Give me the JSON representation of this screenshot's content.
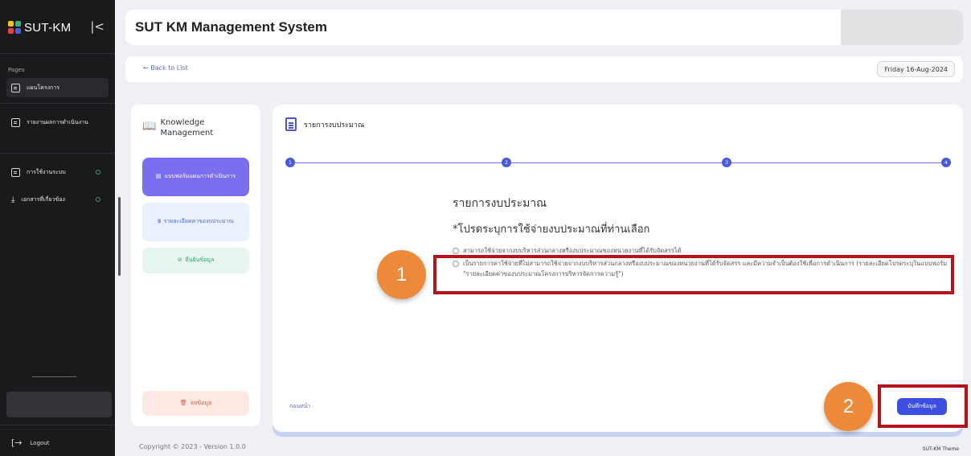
{
  "sidebar": {
    "brand": "SUT-KM",
    "brand_colors": [
      "#f0c419",
      "#35b67a",
      "#e4463b",
      "#4b5fe0"
    ],
    "collapse_icon": "collapse-left-icon",
    "pages_label": "Pages",
    "items": [
      {
        "label": "แผนโครงการ",
        "icon": "table-icon",
        "active": true
      },
      {
        "label": "รายงานผลการดำเนินงาน",
        "icon": "report-icon",
        "active": false
      },
      {
        "label": "การใช้งานระบบ",
        "icon": "grid-icon",
        "active": false,
        "badge_color": "#2ea66a"
      },
      {
        "label": "เอกสารที่เกี่ยวข้อง",
        "icon": "download-icon",
        "active": false,
        "badge_color": "#2ea66a"
      }
    ],
    "logout_label": "Logout"
  },
  "header": {
    "title": "SUT KM Management System"
  },
  "navbar": {
    "back_label": "← Back to List",
    "date": "Friday 16-Aug-2024"
  },
  "left_panel": {
    "title": "Knowledge Management",
    "steps": [
      {
        "label": "แบบฟอร์มแผนการดำเนินการ",
        "icon": "form-icon",
        "state": "active"
      },
      {
        "label": "รายละเอียดค่าของบประมาณ",
        "icon": "money-icon",
        "state": "pending"
      },
      {
        "label": "ยืนยันข้อมูล",
        "icon": "check-circle-icon",
        "state": "pending"
      }
    ],
    "delete_label": "ลบข้อมูล"
  },
  "main_panel": {
    "header": "รายการงบประมาณ",
    "steps": [
      "1",
      "2",
      "3",
      "4"
    ],
    "section_title": "รายการงบประมาณ",
    "section_subtitle": "*โปรดระบุการใช้จ่ายงบประมาณที่ท่านเลือก",
    "options": [
      "สามารถใช้จ่ายจากงบบริหารส่วนกลางหรืองบประมาณของหน่วยงานที่ได้รับจัดสรรได้",
      "เป็นรายการค่าใช้จ่ายที่ไม่สามารถใช้จ่ายจากงบบริหารส่วนกลางหรืองบประมาณของหน่วยงานที่ได้รับจัดสรร และมีความจำเป็นต้องใช้เพื่อการดำเนินการ (รายละเอียดโปรดระบุในแบบฟอร์ม \"รายละเอียดค่าของบประมาณโครงการบริหารจัดการความรู้\")"
    ],
    "prev_label": "ก่อนหน้า",
    "save_label": "บันทึกข้อมูล"
  },
  "annotations": {
    "callout_1": "1",
    "callout_2": "2",
    "highlight_color": "#b3141c",
    "callout_color": "#ed8a3a"
  },
  "footer": {
    "copyright": "Copyright © 2023 - Version 1.0.0",
    "theme": "SUT-KM Theme"
  }
}
